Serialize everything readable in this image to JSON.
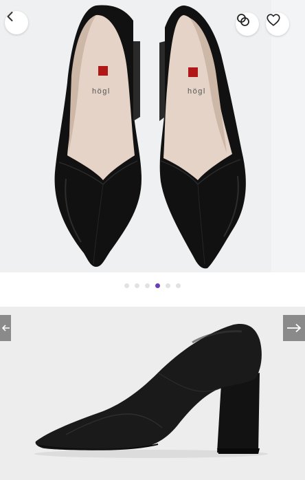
{
  "product_gallery": {
    "image_count": 6,
    "active_index": 3,
    "brand_mark": "högl"
  },
  "icons": {
    "back": "chevron-left-icon",
    "compare": "compare-icon",
    "favorite": "heart-icon",
    "prev": "arrow-left-icon",
    "next": "arrow-right-icon"
  },
  "colors": {
    "accent": "#6a3fb5",
    "dot_inactive": "#e2e2e6"
  }
}
